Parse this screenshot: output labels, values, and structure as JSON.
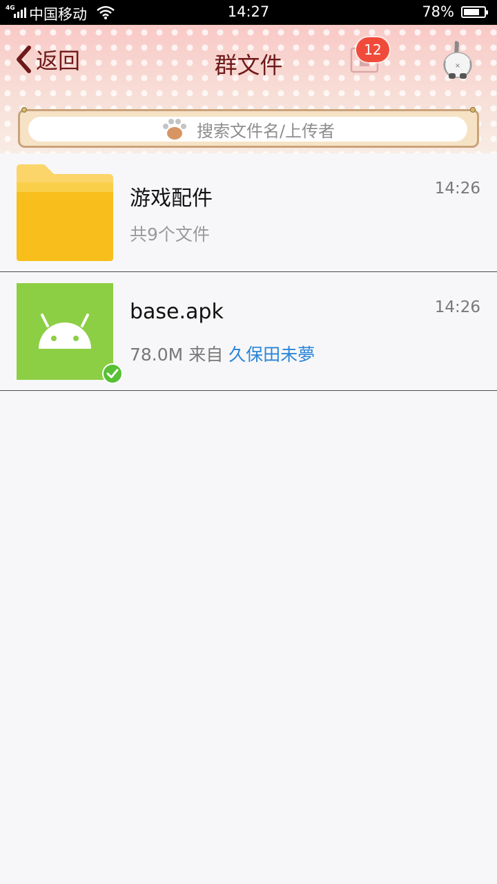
{
  "status_bar": {
    "network": "4G",
    "carrier": "中国移动",
    "time": "14:27",
    "battery_pct": "78%",
    "battery_level": 0.78
  },
  "header": {
    "back_label": "返回",
    "title": "群文件",
    "badge_count": "12",
    "search_placeholder": "搜索文件名/上传者"
  },
  "files": [
    {
      "name": "游戏配件",
      "type": "folder-icon",
      "summary": "共9个文件",
      "time": "14:26"
    },
    {
      "name": "base.apk",
      "type": "android-icon",
      "size": "78.0M",
      "from_label": "来自",
      "uploader": "久保田未夢",
      "time": "14:26",
      "downloaded": true
    }
  ],
  "colors": {
    "title": "#6e1a1a",
    "badge": "#f04b3a",
    "apk_tile": "#8ccf44",
    "folder": "#f8bf1c",
    "uploader_link": "#2a85d8",
    "downloaded_check": "#58c035"
  }
}
